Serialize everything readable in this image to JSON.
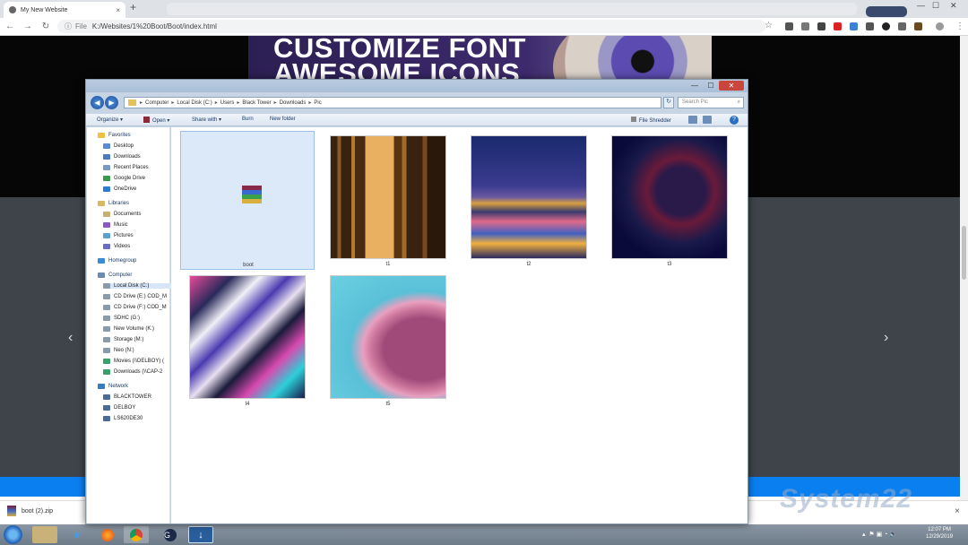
{
  "browser": {
    "tab_title": "My New Website",
    "tab_close": "×",
    "new_tab": "+",
    "url_scheme": "File",
    "url": "K:/Websites/1%20Boot/Boot/index.html"
  },
  "website": {
    "banner_line1": "CUSTOMIZE FONT",
    "banner_line2": "AWESOME ICONS",
    "prev_arrow": "‹",
    "next_arrow": "›"
  },
  "explorer": {
    "breadcrumb": [
      "Computer",
      "Local Disk (C:)",
      "Users",
      "Black Tower",
      "Downloads",
      "Pic"
    ],
    "search_placeholder": "Search Pic",
    "commands": {
      "organize": "Organize ▾",
      "open": "Open ▾",
      "share": "Share with ▾",
      "burn": "Burn",
      "new_folder": "New folder",
      "shredder": "File Shredder"
    },
    "nav": {
      "favorites_header": "Favorites",
      "favorites": [
        "Desktop",
        "Downloads",
        "Recent Places",
        "Google Drive",
        "OneDrive"
      ],
      "libraries_header": "Libraries",
      "libraries": [
        "Documents",
        "Music",
        "Pictures",
        "Videos"
      ],
      "homegroup": "Homegroup",
      "computer_header": "Computer",
      "drives": [
        "Local Disk (C:)",
        "CD Drive (E:) COD_M",
        "CD Drive (F:) COD_M",
        "SDHC (G:)",
        "New Volume (K:)",
        "Storage (M:)",
        "Neo (N:)",
        "Movies (\\\\DELBOY) (",
        "Downloads (\\\\CAP-2"
      ],
      "network_header": "Network",
      "network": [
        "BLACKTOWER",
        "DELBOY",
        "LS620DE30"
      ]
    },
    "files": [
      {
        "name": "boot",
        "kind": "zip"
      },
      {
        "name": "t1",
        "kind": "forest"
      },
      {
        "name": "t2",
        "kind": "city"
      },
      {
        "name": "t3",
        "kind": "portrait"
      },
      {
        "name": "t4",
        "kind": "abstract"
      },
      {
        "name": "t5",
        "kind": "wave"
      }
    ]
  },
  "download_bar": {
    "file": "boot (2).zip",
    "close": "×"
  },
  "taskbar": {
    "time": "12:07 PM",
    "date": "12/29/2019"
  },
  "watermark": "System22",
  "colors": {
    "site_blue": "#0a7ff0",
    "site_gray": "#3f444a",
    "banner_purple": "#3d2a6d",
    "selection_blue": "#dbe9f8"
  }
}
